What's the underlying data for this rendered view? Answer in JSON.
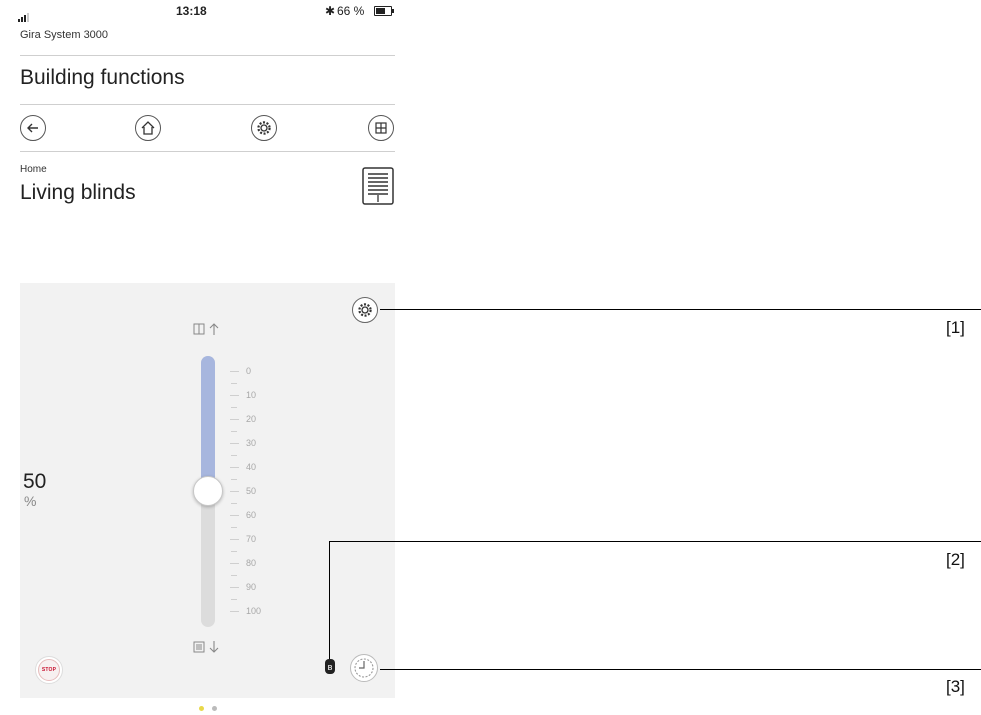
{
  "status_bar": {
    "time": "13:18",
    "bluetooth": "✱",
    "battery": "66 %"
  },
  "app_name": "Gira System 3000",
  "header": {
    "title": "Building functions"
  },
  "toolbar": {
    "icons": [
      "back-arrow-icon",
      "home-icon",
      "settings-gear-icon",
      "grid-icon"
    ]
  },
  "breadcrumb": "Home",
  "device": {
    "name": "Living blinds",
    "icon": "blind-icon"
  },
  "control": {
    "value": "50",
    "unit": "%",
    "position_fraction": 0.5,
    "scale_labels": [
      "0",
      "10",
      "20",
      "30",
      "40",
      "50",
      "60",
      "70",
      "80",
      "90",
      "100"
    ],
    "stop_label": "STOP",
    "bt_status": "ʙ",
    "fill_color": "#a7b6de"
  },
  "pager": {
    "pages": 2,
    "active": 0,
    "active_color": "#e8d84a"
  },
  "callouts": [
    "[1]",
    "[2]",
    "[3]"
  ]
}
